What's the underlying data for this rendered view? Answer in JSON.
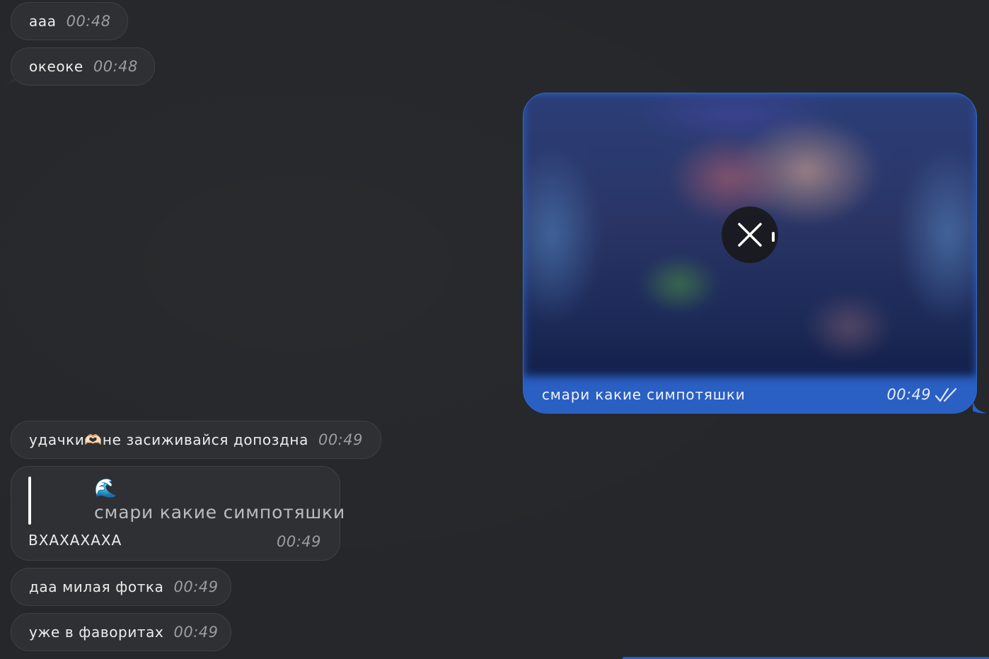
{
  "messages": {
    "m1": {
      "text": "ааа",
      "time": "00:48"
    },
    "m2": {
      "text": "океоке",
      "time": "00:48"
    },
    "photo": {
      "caption": "смари какие симпотяшки",
      "time": "00:49"
    },
    "m3": {
      "text": "удачки🫶🏻не засиживайся допоздна",
      "time": "00:49"
    },
    "reply": {
      "quoted_emoji": "🌊",
      "quoted_text": "смари какие симпотяшки",
      "text": "ВХАХАХАХА",
      "time": "00:49"
    },
    "m4": {
      "text": "даа милая фотка",
      "time": "00:49"
    },
    "m5": {
      "text": "уже в фаворитах",
      "time": "00:49"
    }
  },
  "colors": {
    "background": "#25272a",
    "incoming_bubble": "#2f3033",
    "outgoing_bubble": "#2a5fc4"
  },
  "icons": {
    "cancel": "close-icon",
    "read_status": "double-check-icon"
  }
}
